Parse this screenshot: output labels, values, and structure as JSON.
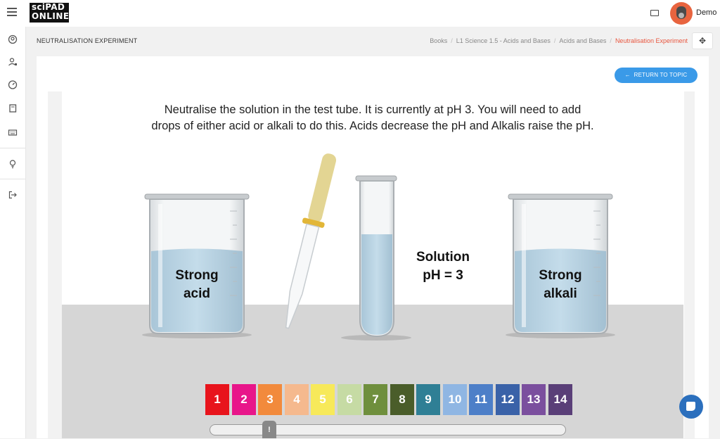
{
  "app": {
    "logo_line1": "sciPAD",
    "logo_line2": "ONLINE",
    "user_name": "Demo",
    "icons": {
      "menu": "hamburger-icon",
      "keyboard": "keyboard-icon",
      "avatar": "gorilla-avatar",
      "sidebar": [
        "user-circle-icon",
        "user-edit-icon",
        "dashboard-gauge-icon",
        "book-icon",
        "keyboard-icon",
        "lightbulb-icon",
        "logout-icon"
      ]
    }
  },
  "page": {
    "title": "NEUTRALISATION EXPERIMENT",
    "breadcrumbs": [
      "Books",
      "L1 Science 1.5 - Acids and Bases",
      "Acids and Bases",
      "Neutralisation Experiment"
    ],
    "return_button": "RETURN TO TOPIC",
    "accent_color": "#e8563f",
    "button_color": "#3a9ae8"
  },
  "experiment": {
    "instructions_line1": "Neutralise the solution in the test tube. It is currently at pH 3. You will need to add",
    "instructions_line2": "drops of either acid or alkali to do this. Acids decrease the pH and Alkalis raise the pH.",
    "acid_line1": "Strong",
    "acid_line2": "acid",
    "alkali_line1": "Strong",
    "alkali_line2": "alkali",
    "solution_line1": "Solution",
    "solution_line2": "pH = 3",
    "current_ph": 3,
    "slider_thumb_label": "!",
    "ph_scale": [
      {
        "label": "1",
        "color": "#e8141c"
      },
      {
        "label": "2",
        "color": "#e8168a"
      },
      {
        "label": "3",
        "color": "#f28a3c"
      },
      {
        "label": "4",
        "color": "#f5b98e"
      },
      {
        "label": "5",
        "color": "#f7e95a"
      },
      {
        "label": "6",
        "color": "#c6dba4"
      },
      {
        "label": "7",
        "color": "#6f8f3d"
      },
      {
        "label": "8",
        "color": "#4a5d2a"
      },
      {
        "label": "9",
        "color": "#2f7f95"
      },
      {
        "label": "10",
        "color": "#8fb6e3"
      },
      {
        "label": "11",
        "color": "#4d7fc8"
      },
      {
        "label": "12",
        "color": "#3a62a8"
      },
      {
        "label": "13",
        "color": "#7b4f9e"
      },
      {
        "label": "14",
        "color": "#5a3f78"
      }
    ]
  }
}
